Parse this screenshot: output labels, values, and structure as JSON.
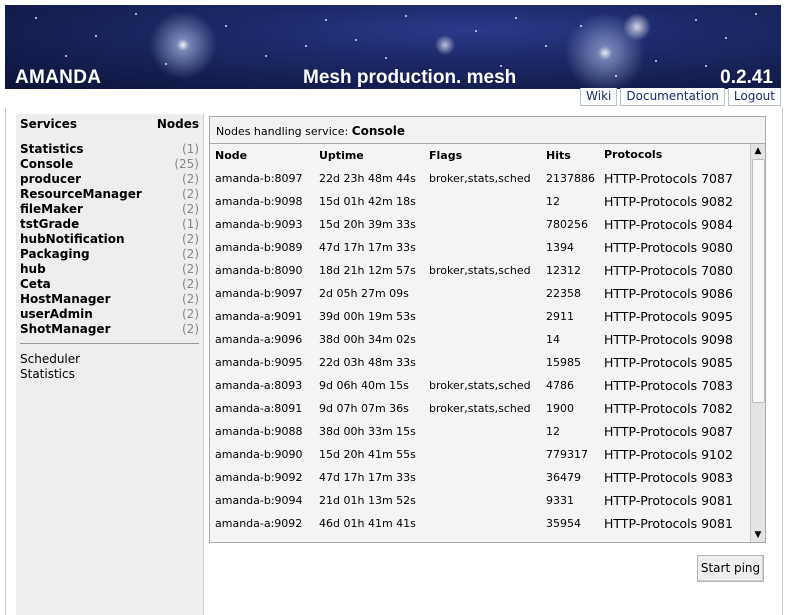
{
  "header": {
    "app_name": "AMANDA",
    "title": "Mesh production. mesh",
    "version": "0.2.41"
  },
  "toplinks": [
    "Wiki",
    "Documentation",
    "Logout"
  ],
  "sidebar": {
    "services_label": "Services",
    "nodes_label": "Nodes",
    "services": [
      {
        "name": "Statistics",
        "count": "(1)"
      },
      {
        "name": "Console",
        "count": "(25)"
      },
      {
        "name": "producer",
        "count": "(2)"
      },
      {
        "name": "ResourceManager",
        "count": "(2)"
      },
      {
        "name": "fileMaker",
        "count": "(2)"
      },
      {
        "name": "tstGrade",
        "count": "(1)"
      },
      {
        "name": "hubNotification",
        "count": "(2)"
      },
      {
        "name": "Packaging",
        "count": "(2)"
      },
      {
        "name": "hub",
        "count": "(2)"
      },
      {
        "name": "Ceta",
        "count": "(2)"
      },
      {
        "name": "HostManager",
        "count": "(2)"
      },
      {
        "name": "userAdmin",
        "count": "(2)"
      },
      {
        "name": "ShotManager",
        "count": "(2)"
      }
    ],
    "links": [
      "Scheduler",
      "Statistics"
    ]
  },
  "panel": {
    "title_prefix": "Nodes handling service:",
    "service": "Console"
  },
  "table": {
    "columns": [
      "Node",
      "Uptime",
      "Flags",
      "Hits",
      "Protocols"
    ],
    "rows": [
      {
        "node": "amanda-b:8097",
        "uptime": "22d 23h 48m 44s",
        "flags": "broker,stats,sched",
        "hits": "2137886",
        "protocols": "HTTP-Protocols 7087"
      },
      {
        "node": "amanda-b:9098",
        "uptime": "15d 01h 42m 18s",
        "flags": "",
        "hits": "12",
        "protocols": "HTTP-Protocols 9082"
      },
      {
        "node": "amanda-b:9093",
        "uptime": "15d 20h 39m 33s",
        "flags": "",
        "hits": "780256",
        "protocols": "HTTP-Protocols 9084"
      },
      {
        "node": "amanda-b:9089",
        "uptime": "47d 17h 17m 33s",
        "flags": "",
        "hits": "1394",
        "protocols": "HTTP-Protocols 9080"
      },
      {
        "node": "amanda-b:8090",
        "uptime": "18d 21h 12m 57s",
        "flags": "broker,stats,sched",
        "hits": "12312",
        "protocols": "HTTP-Protocols 7080"
      },
      {
        "node": "amanda-b:9097",
        "uptime": "2d 05h 27m 09s",
        "flags": "",
        "hits": "22358",
        "protocols": "HTTP-Protocols 9086"
      },
      {
        "node": "amanda-a:9091",
        "uptime": "39d 00h 19m 53s",
        "flags": "",
        "hits": "2911",
        "protocols": "HTTP-Protocols 9095"
      },
      {
        "node": "amanda-a:9096",
        "uptime": "38d 00h 34m 02s",
        "flags": "",
        "hits": "14",
        "protocols": "HTTP-Protocols 9098"
      },
      {
        "node": "amanda-b:9095",
        "uptime": "22d 03h 48m 33s",
        "flags": "",
        "hits": "15985",
        "protocols": "HTTP-Protocols 9085"
      },
      {
        "node": "amanda-a:8093",
        "uptime": "9d 06h 40m 15s",
        "flags": "broker,stats,sched",
        "hits": "4786",
        "protocols": "HTTP-Protocols 7083"
      },
      {
        "node": "amanda-a:8091",
        "uptime": "9d 07h 07m 36s",
        "flags": "broker,stats,sched",
        "hits": "1900",
        "protocols": "HTTP-Protocols 7082"
      },
      {
        "node": "amanda-b:9088",
        "uptime": "38d 00h 33m 15s",
        "flags": "",
        "hits": "12",
        "protocols": "HTTP-Protocols 9087"
      },
      {
        "node": "amanda-b:9090",
        "uptime": "15d 20h 41m 55s",
        "flags": "",
        "hits": "779317",
        "protocols": "HTTP-Protocols 9102"
      },
      {
        "node": "amanda-b:9092",
        "uptime": "47d 17h 17m 33s",
        "flags": "",
        "hits": "36479",
        "protocols": "HTTP-Protocols 9083"
      },
      {
        "node": "amanda-b:9094",
        "uptime": "21d 01h 13m 52s",
        "flags": "",
        "hits": "9331",
        "protocols": "HTTP-Protocols 9081"
      },
      {
        "node": "amanda-a:9092",
        "uptime": "46d 01h 41m 41s",
        "flags": "",
        "hits": "35954",
        "protocols": "HTTP-Protocols 9081"
      }
    ]
  },
  "scrollbar": {
    "up_icon": "scroll-up-arrow-icon",
    "down_icon": "scroll-down-arrow-icon"
  },
  "ping_button": "Start ping"
}
